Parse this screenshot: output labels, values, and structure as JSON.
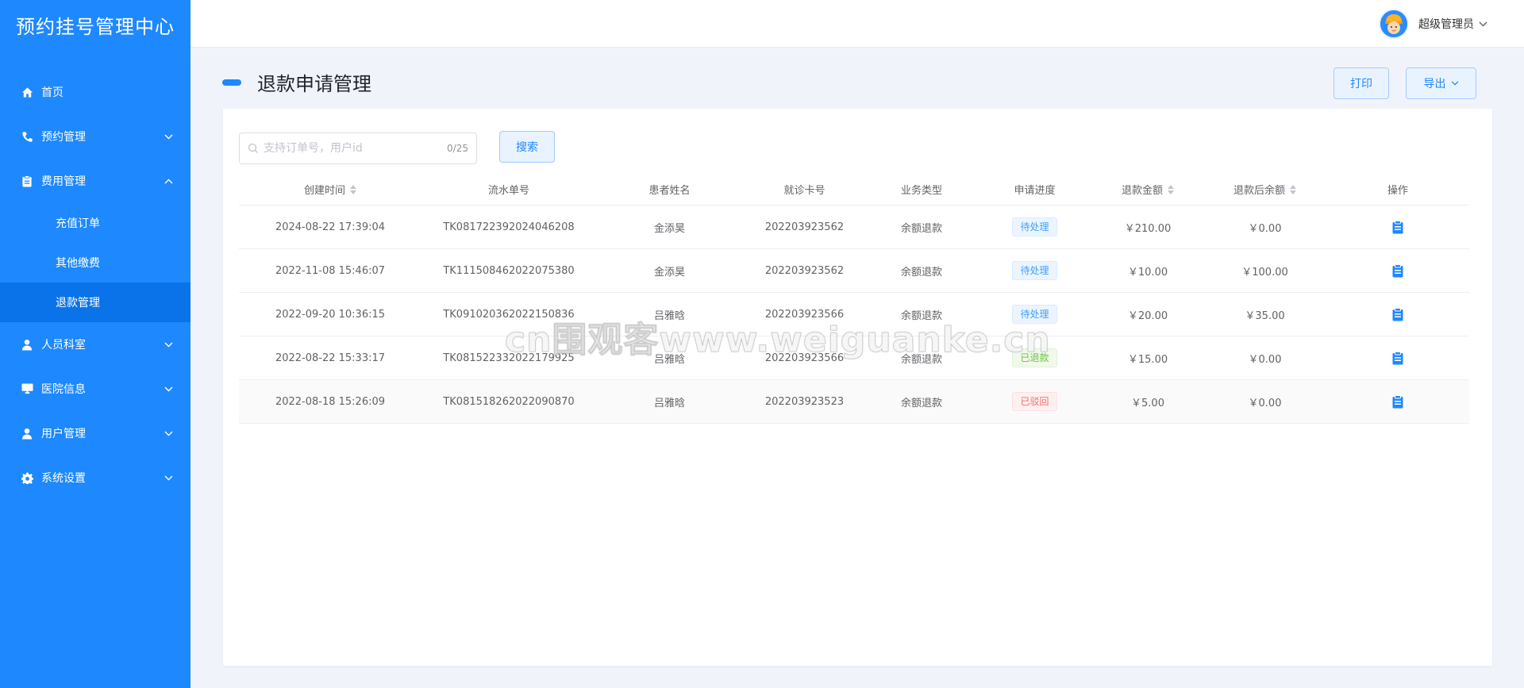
{
  "app": {
    "brand": "预约挂号管理中心"
  },
  "sidebar": {
    "items": [
      {
        "label": "首页",
        "icon": "home-icon"
      },
      {
        "label": "预约管理",
        "icon": "phone-icon"
      },
      {
        "label": "费用管理",
        "icon": "clipboard-icon",
        "expanded": true
      },
      {
        "label": "人员科室",
        "icon": "person-icon"
      },
      {
        "label": "医院信息",
        "icon": "monitor-icon"
      },
      {
        "label": "用户管理",
        "icon": "person-icon"
      },
      {
        "label": "系统设置",
        "icon": "gear-icon"
      }
    ],
    "sub_items": [
      {
        "label": "充值订单"
      },
      {
        "label": "其他缴费"
      },
      {
        "label": "退款管理",
        "active": true
      }
    ]
  },
  "header": {
    "user_name": "超级管理员"
  },
  "page": {
    "title": "退款申请管理",
    "print_label": "打印",
    "export_label": "导出"
  },
  "search": {
    "placeholder": "支持订单号，用户id",
    "counter": "0/25",
    "button": "搜索"
  },
  "table": {
    "columns": [
      "创建时间",
      "流水单号",
      "患者姓名",
      "就诊卡号",
      "业务类型",
      "申请进度",
      "退款金额",
      "退款后余额",
      "操作"
    ],
    "rows": [
      {
        "created": "2024-08-22 17:39:04",
        "serial": "TK081722392024046208",
        "patient": "金添昊",
        "card": "202203923562",
        "type": "余额退款",
        "status": "待处理",
        "status_kind": "pending",
        "amount": "￥210.00",
        "balance": "￥0.00"
      },
      {
        "created": "2022-11-08 15:46:07",
        "serial": "TK111508462022075380",
        "patient": "金添昊",
        "card": "202203923562",
        "type": "余额退款",
        "status": "待处理",
        "status_kind": "pending",
        "amount": "￥10.00",
        "balance": "￥100.00"
      },
      {
        "created": "2022-09-20 10:36:15",
        "serial": "TK091020362022150836",
        "patient": "吕雅晗",
        "card": "202203923566",
        "type": "余额退款",
        "status": "待处理",
        "status_kind": "pending",
        "amount": "￥20.00",
        "balance": "￥35.00"
      },
      {
        "created": "2022-08-22 15:33:17",
        "serial": "TK081522332022179925",
        "patient": "吕雅晗",
        "card": "202203923566",
        "type": "余额退款",
        "status": "已退款",
        "status_kind": "done",
        "amount": "￥15.00",
        "balance": "￥0.00"
      },
      {
        "created": "2022-08-18 15:26:09",
        "serial": "TK081518262022090870",
        "patient": "吕雅晗",
        "card": "202203923523",
        "type": "余额退款",
        "status": "已驳回",
        "status_kind": "rejected",
        "amount": "￥5.00",
        "balance": "￥0.00"
      }
    ]
  },
  "watermark": "cn围观客www.weiguanke.cn",
  "colors": {
    "primary": "#1e88ff",
    "sidebar_active": "#0b73ea"
  }
}
